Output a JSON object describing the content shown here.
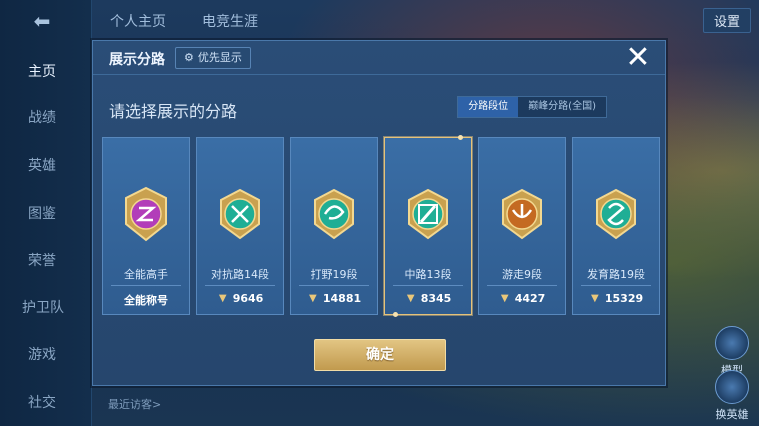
{
  "background": {
    "top_tabs": [
      "个人主页",
      "电竞生涯"
    ],
    "settings_label": "设置",
    "nav_items": [
      "主页",
      "战绩",
      "英雄",
      "图鉴",
      "荣誉",
      "护卫队",
      "游戏",
      "社交"
    ],
    "side_widgets": [
      "模型",
      "换英雄"
    ],
    "recent_visitors": "最近访客>"
  },
  "modal": {
    "title": "展示分路",
    "priority_label": "优先显示",
    "subtitle": "请选择展示的分路",
    "segment": {
      "options": [
        "分路段位",
        "巅峰分路(全国)"
      ],
      "active_index": 0
    },
    "cards": [
      {
        "name": "全能高手",
        "bottom_text": "全能称号",
        "badge": "purple-emblem",
        "selected": false
      },
      {
        "name": "对抗路14段",
        "bottom_text": "9646",
        "badge": "green-emblem",
        "selected": false
      },
      {
        "name": "打野19段",
        "bottom_text": "14881",
        "badge": "green-emblem",
        "selected": false
      },
      {
        "name": "中路13段",
        "bottom_text": "8345",
        "badge": "green-emblem",
        "selected": true
      },
      {
        "name": "游走9段",
        "bottom_text": "4427",
        "badge": "orange-emblem",
        "selected": false
      },
      {
        "name": "发育路19段",
        "bottom_text": "15329",
        "badge": "green-emblem",
        "selected": false
      }
    ],
    "confirm_label": "确定"
  },
  "colors": {
    "accent_gold": "#e2c583",
    "selected_border": "#e5c27a",
    "segment_active": "#2e62a8"
  }
}
